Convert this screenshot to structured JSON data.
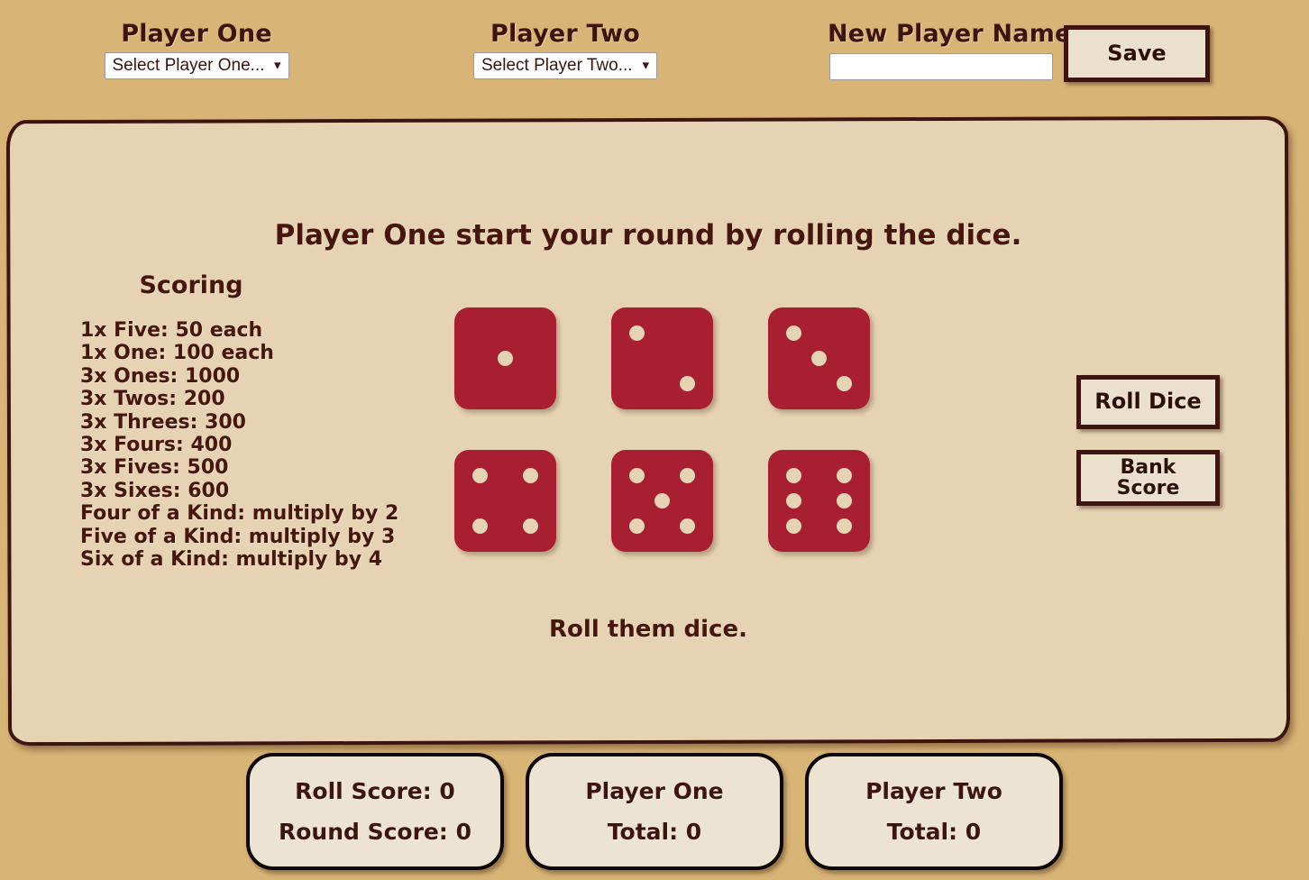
{
  "topbar": {
    "player_one": {
      "label": "Player One",
      "select_value": "Select Player One...",
      "chevron_icon": "chevron-down-icon"
    },
    "player_two": {
      "label": "Player Two",
      "select_value": "Select Player Two...",
      "chevron_icon": "chevron-down-icon"
    },
    "new_player": {
      "label": "New Player Name",
      "input_value": "",
      "input_placeholder": ""
    },
    "save_label": "Save"
  },
  "panel": {
    "prompt": "Player One start your round by rolling the dice.",
    "roll_message": "Roll them dice."
  },
  "scoring": {
    "heading": "Scoring",
    "rules": [
      "1x Five: 50 each",
      "1x One: 100 each",
      "3x Ones: 1000",
      "3x Twos: 200",
      "3x Threes: 300",
      "3x Fours: 400",
      "3x Fives: 500",
      "3x Sixes: 600",
      "Four of a Kind: multiply by 2",
      "Five of a Kind: multiply by 3",
      "Six of a Kind: multiply by 4"
    ]
  },
  "dice": {
    "values": [
      1,
      2,
      3,
      4,
      5,
      6
    ],
    "face_color": "#a81f32",
    "pip_color": "#e5d3b3"
  },
  "actions": {
    "roll_dice_label": "Roll Dice",
    "bank_score_line1": "Bank",
    "bank_score_line2": "Score"
  },
  "scores": {
    "cards": [
      {
        "line1": "Roll Score: 0",
        "line2": "Round Score: 0"
      },
      {
        "line1": "Player One",
        "line2": "Total: 0"
      },
      {
        "line1": "Player Two",
        "line2": "Total: 0"
      }
    ]
  },
  "colors": {
    "panel_fill": "#e5d3b3",
    "card_fill": "#ede3d3",
    "outline": "#3d1410",
    "dice_red": "#a81f32"
  }
}
